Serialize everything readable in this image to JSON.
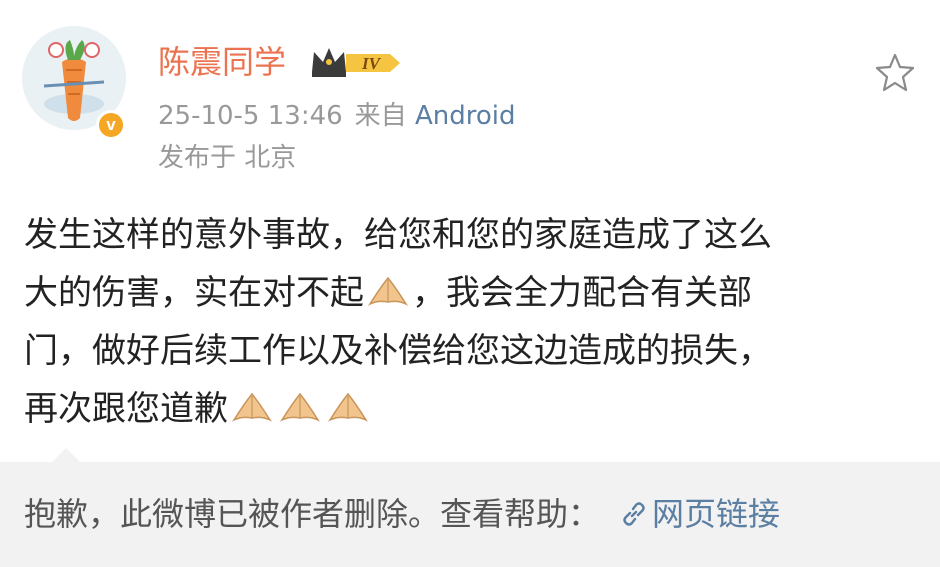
{
  "post": {
    "username": "陈震同学",
    "level_badge": "IV",
    "date": "25-10-5 13:46",
    "source_prefix": "来自",
    "source": "Android",
    "location": "发布于 北京",
    "content_lines": [
      "发生这样的意外事故，给您和您的家庭造成了这么",
      "大的伤害，实在对不起",
      "，我会全力配合有关部",
      "门，做好后续工作以及补偿给您这边造成的损失，",
      "再次跟您道歉"
    ],
    "emoji_name": "pray-hands-emoji",
    "verified_icon": "verified-v-icon",
    "favorite_icon": "star-icon",
    "accent_color": "#eb7350",
    "link_color": "#5b7ea3"
  },
  "footer": {
    "notice": "抱歉，此微博已被作者删除。查看帮助：",
    "link_label": "网页链接",
    "link_icon": "link-icon"
  }
}
